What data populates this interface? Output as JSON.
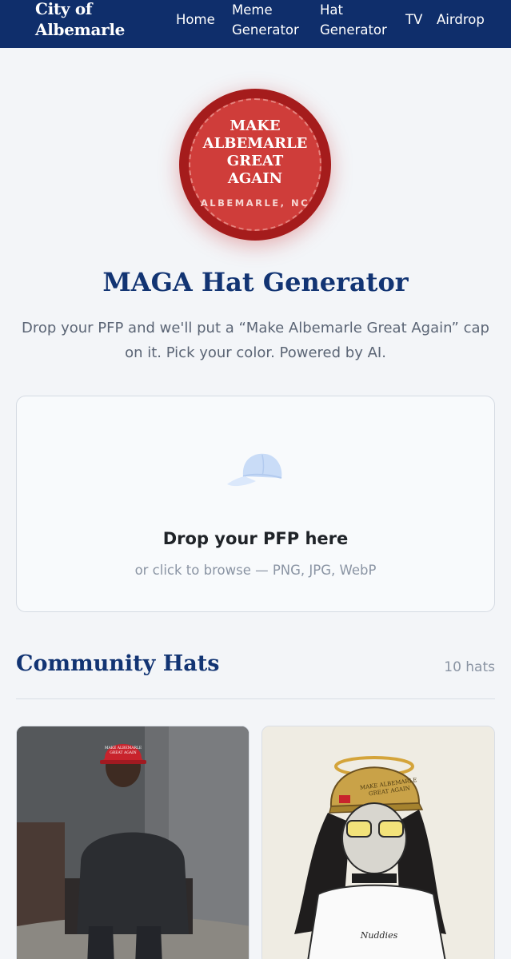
{
  "nav": {
    "brand": "City of Albemarle",
    "links": [
      "Home",
      "Meme Generator",
      "Hat Generator",
      "TV",
      "Airdrop"
    ]
  },
  "badge": {
    "lines": [
      "MAKE",
      "ALBEMARLE",
      "GREAT",
      "AGAIN"
    ],
    "location": "ALBEMARLE, NC"
  },
  "hero": {
    "title": "MAGA Hat Generator",
    "subtitle": "Drop your PFP and we'll put a “Make Albemarle Great Again” cap on it. Pick your color. Powered by AI."
  },
  "dropzone": {
    "icon": "cap-icon",
    "title": "Drop your PFP here",
    "subtitle": "or click to browse — PNG, JPG, WebP"
  },
  "community": {
    "title": "Community Hats",
    "count": "10 hats",
    "cards": [
      {
        "hat_text": "MAKE ALBEMARLE GREAT AGAIN",
        "hat_color": "#c8232c"
      },
      {
        "hat_text": "MAKE ALBEMARLE GREAT AGAIN",
        "hat_color": "#c9a248",
        "shirt_text": "Nuddies"
      }
    ]
  },
  "colors": {
    "nav_bg": "#0f2e6b",
    "title": "#123473",
    "badge_red": "#cf3d3a"
  }
}
